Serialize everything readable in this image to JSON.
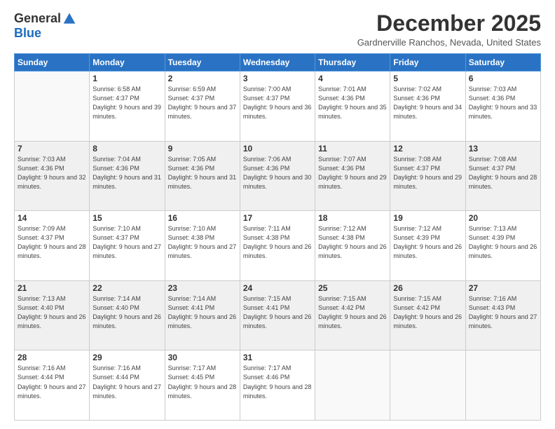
{
  "logo": {
    "general": "General",
    "blue": "Blue"
  },
  "title": "December 2025",
  "location": "Gardnerville Ranchos, Nevada, United States",
  "days_of_week": [
    "Sunday",
    "Monday",
    "Tuesday",
    "Wednesday",
    "Thursday",
    "Friday",
    "Saturday"
  ],
  "weeks": [
    [
      {
        "day": "",
        "empty": true
      },
      {
        "day": "1",
        "sunrise": "6:58 AM",
        "sunset": "4:37 PM",
        "daylight": "9 hours and 39 minutes."
      },
      {
        "day": "2",
        "sunrise": "6:59 AM",
        "sunset": "4:37 PM",
        "daylight": "9 hours and 37 minutes."
      },
      {
        "day": "3",
        "sunrise": "7:00 AM",
        "sunset": "4:37 PM",
        "daylight": "9 hours and 36 minutes."
      },
      {
        "day": "4",
        "sunrise": "7:01 AM",
        "sunset": "4:36 PM",
        "daylight": "9 hours and 35 minutes."
      },
      {
        "day": "5",
        "sunrise": "7:02 AM",
        "sunset": "4:36 PM",
        "daylight": "9 hours and 34 minutes."
      },
      {
        "day": "6",
        "sunrise": "7:03 AM",
        "sunset": "4:36 PM",
        "daylight": "9 hours and 33 minutes."
      }
    ],
    [
      {
        "day": "7",
        "sunrise": "7:03 AM",
        "sunset": "4:36 PM",
        "daylight": "9 hours and 32 minutes."
      },
      {
        "day": "8",
        "sunrise": "7:04 AM",
        "sunset": "4:36 PM",
        "daylight": "9 hours and 31 minutes."
      },
      {
        "day": "9",
        "sunrise": "7:05 AM",
        "sunset": "4:36 PM",
        "daylight": "9 hours and 31 minutes."
      },
      {
        "day": "10",
        "sunrise": "7:06 AM",
        "sunset": "4:36 PM",
        "daylight": "9 hours and 30 minutes."
      },
      {
        "day": "11",
        "sunrise": "7:07 AM",
        "sunset": "4:36 PM",
        "daylight": "9 hours and 29 minutes."
      },
      {
        "day": "12",
        "sunrise": "7:08 AM",
        "sunset": "4:37 PM",
        "daylight": "9 hours and 29 minutes."
      },
      {
        "day": "13",
        "sunrise": "7:08 AM",
        "sunset": "4:37 PM",
        "daylight": "9 hours and 28 minutes."
      }
    ],
    [
      {
        "day": "14",
        "sunrise": "7:09 AM",
        "sunset": "4:37 PM",
        "daylight": "9 hours and 28 minutes."
      },
      {
        "day": "15",
        "sunrise": "7:10 AM",
        "sunset": "4:37 PM",
        "daylight": "9 hours and 27 minutes."
      },
      {
        "day": "16",
        "sunrise": "7:10 AM",
        "sunset": "4:38 PM",
        "daylight": "9 hours and 27 minutes."
      },
      {
        "day": "17",
        "sunrise": "7:11 AM",
        "sunset": "4:38 PM",
        "daylight": "9 hours and 26 minutes."
      },
      {
        "day": "18",
        "sunrise": "7:12 AM",
        "sunset": "4:38 PM",
        "daylight": "9 hours and 26 minutes."
      },
      {
        "day": "19",
        "sunrise": "7:12 AM",
        "sunset": "4:39 PM",
        "daylight": "9 hours and 26 minutes."
      },
      {
        "day": "20",
        "sunrise": "7:13 AM",
        "sunset": "4:39 PM",
        "daylight": "9 hours and 26 minutes."
      }
    ],
    [
      {
        "day": "21",
        "sunrise": "7:13 AM",
        "sunset": "4:40 PM",
        "daylight": "9 hours and 26 minutes."
      },
      {
        "day": "22",
        "sunrise": "7:14 AM",
        "sunset": "4:40 PM",
        "daylight": "9 hours and 26 minutes."
      },
      {
        "day": "23",
        "sunrise": "7:14 AM",
        "sunset": "4:41 PM",
        "daylight": "9 hours and 26 minutes."
      },
      {
        "day": "24",
        "sunrise": "7:15 AM",
        "sunset": "4:41 PM",
        "daylight": "9 hours and 26 minutes."
      },
      {
        "day": "25",
        "sunrise": "7:15 AM",
        "sunset": "4:42 PM",
        "daylight": "9 hours and 26 minutes."
      },
      {
        "day": "26",
        "sunrise": "7:15 AM",
        "sunset": "4:42 PM",
        "daylight": "9 hours and 26 minutes."
      },
      {
        "day": "27",
        "sunrise": "7:16 AM",
        "sunset": "4:43 PM",
        "daylight": "9 hours and 27 minutes."
      }
    ],
    [
      {
        "day": "28",
        "sunrise": "7:16 AM",
        "sunset": "4:44 PM",
        "daylight": "9 hours and 27 minutes."
      },
      {
        "day": "29",
        "sunrise": "7:16 AM",
        "sunset": "4:44 PM",
        "daylight": "9 hours and 27 minutes."
      },
      {
        "day": "30",
        "sunrise": "7:17 AM",
        "sunset": "4:45 PM",
        "daylight": "9 hours and 28 minutes."
      },
      {
        "day": "31",
        "sunrise": "7:17 AM",
        "sunset": "4:46 PM",
        "daylight": "9 hours and 28 minutes."
      },
      {
        "day": "",
        "empty": true
      },
      {
        "day": "",
        "empty": true
      },
      {
        "day": "",
        "empty": true
      }
    ]
  ]
}
